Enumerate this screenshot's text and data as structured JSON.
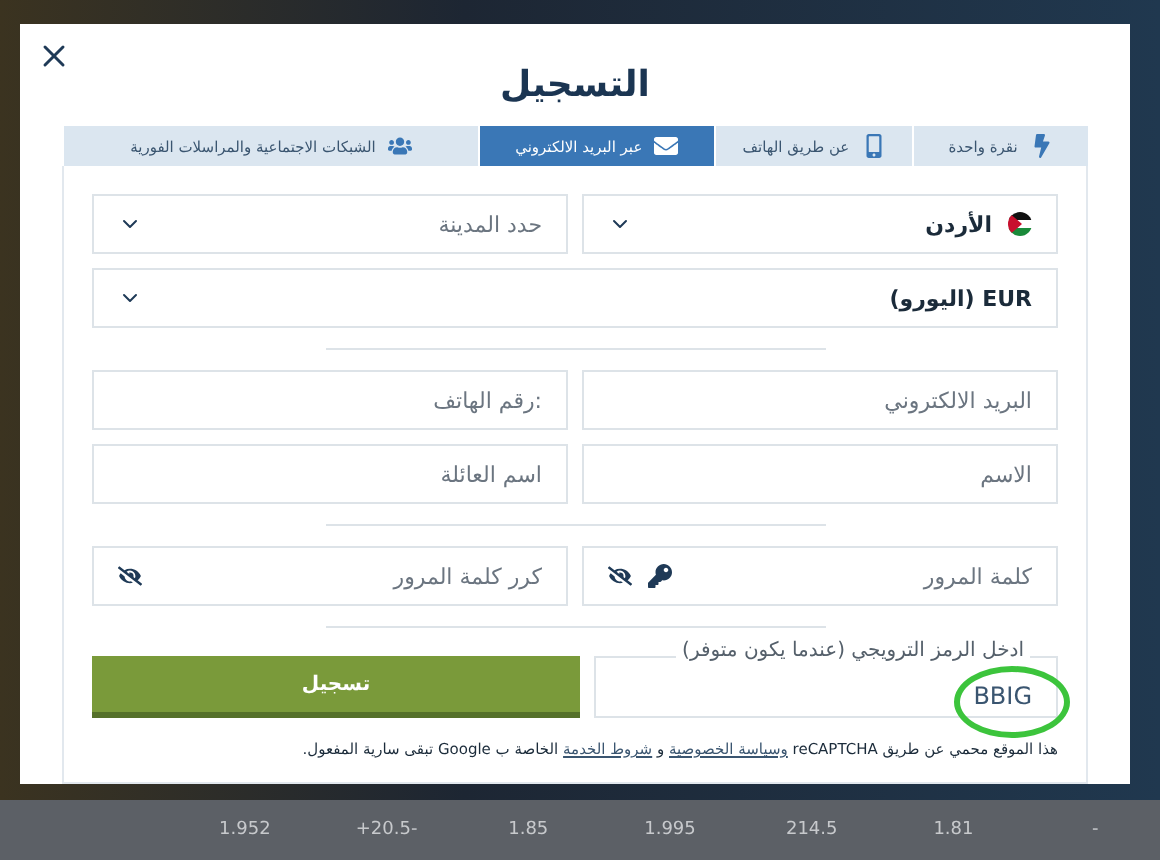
{
  "modal": {
    "title": "التسجيل"
  },
  "tabs": [
    {
      "label": "نقرة واحدة",
      "selected": false
    },
    {
      "label": "عن طريق الهاتف",
      "selected": false
    },
    {
      "label": "عبر البريد الالكتروني",
      "selected": true
    },
    {
      "label": "الشبكات الاجتماعية والمراسلات الفورية",
      "selected": false
    }
  ],
  "selects": [
    {
      "value": "الأردن",
      "kind": "flag"
    },
    {
      "placeholder": "حدد المدينة",
      "kind": "plain"
    }
  ],
  "currency": {
    "value": "EUR (اليورو)"
  },
  "contact_fields": [
    {
      "placeholder": "البريد الالكتروني"
    },
    {
      "placeholder": ":رقم الهاتف"
    },
    {
      "placeholder": "الاسم"
    },
    {
      "placeholder": "اسم العائلة"
    }
  ],
  "password_fields": [
    {
      "placeholder": "كلمة المرور",
      "key_icon": true
    },
    {
      "placeholder": "كرر كلمة المرور",
      "key_icon": false
    }
  ],
  "promo": {
    "label": "ادخل الرمز الترويجي (عندما يكون متوفر)",
    "value": "BBIG",
    "circled": true
  },
  "submit": {
    "label": "تسجيل"
  },
  "recaptcha": [
    {
      "kind": "text",
      "text": "هذا الموقع محمي عن طريق reCAPTCHA"
    },
    {
      "kind": "link",
      "text": "وسياسة الخصوصية"
    },
    {
      "kind": "text",
      "text": "و"
    },
    {
      "kind": "link",
      "text": "شروط الخدمة"
    },
    {
      "kind": "text",
      "text": "الخاصة ب Google تبقى سارية المفعول."
    }
  ],
  "background_odds": [
    "-",
    "1.81",
    "214.5",
    "1.995",
    "1.85",
    "+20.5-",
    "1.952"
  ]
}
